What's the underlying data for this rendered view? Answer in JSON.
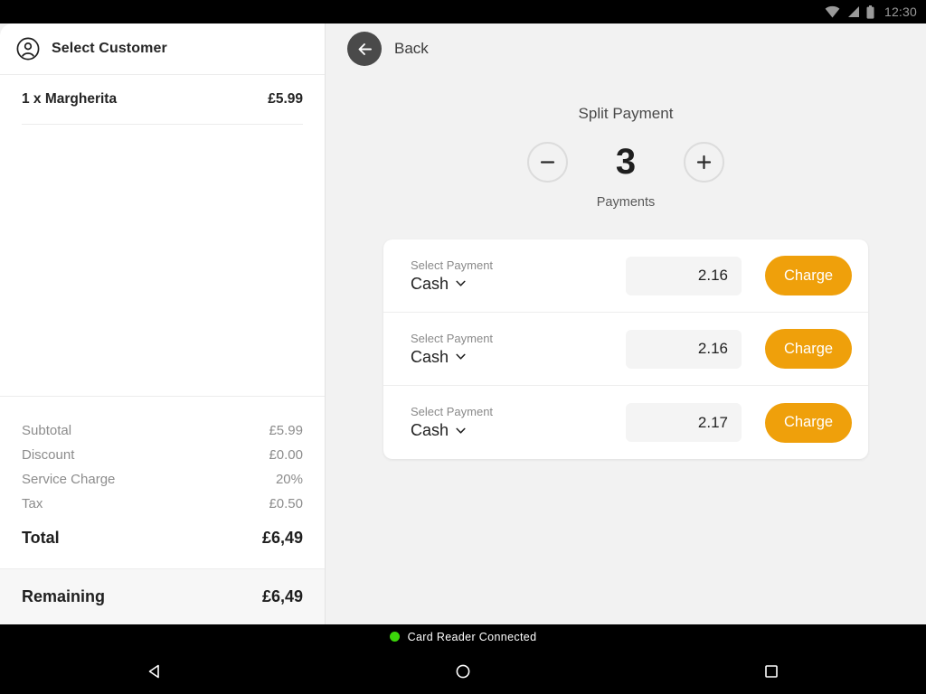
{
  "statusbar": {
    "time": "12:30",
    "icons": [
      "wifi-icon",
      "signal-icon",
      "battery-icon"
    ]
  },
  "ticket": {
    "customer": {
      "label": "Select Customer",
      "icon": "user-circle-icon"
    },
    "line_items": [
      {
        "name": "1 x Margherita",
        "price": "£5.99"
      }
    ],
    "totals": [
      {
        "label": "Subtotal",
        "value": "£5.99"
      },
      {
        "label": "Discount",
        "value": "£0.00"
      },
      {
        "label": "Service Charge",
        "value": "20%"
      },
      {
        "label": "Tax",
        "value": "£0.50"
      }
    ],
    "grand_total": {
      "label": "Total",
      "value": "£6,49"
    },
    "remaining": {
      "label": "Remaining",
      "value": "£6,49"
    }
  },
  "split": {
    "back_label": "Back",
    "back_icon": "arrow-left-icon",
    "title": "Split Payment",
    "decrement_icon": "minus-icon",
    "increment_icon": "plus-icon",
    "count": "3",
    "count_label": "Payments",
    "rows": [
      {
        "hint": "Select Payment",
        "method": "Cash",
        "chevron": "chevron-down-icon",
        "amount": "2.16",
        "amount_placeholder": "0.00",
        "charge_label": "Charge"
      },
      {
        "hint": "Select Payment",
        "method": "Cash",
        "chevron": "chevron-down-icon",
        "amount": "2.16",
        "amount_placeholder": "0.00",
        "charge_label": "Charge"
      },
      {
        "hint": "Select Payment",
        "method": "Cash",
        "chevron": "chevron-down-icon",
        "amount": "2.17",
        "amount_placeholder": "0.00",
        "charge_label": "Charge"
      }
    ]
  },
  "reader": {
    "status_text": "Card Reader Connected",
    "status_color": "#3bd60a"
  },
  "navbar": {
    "back": "back-triangle-icon",
    "home": "home-circle-icon",
    "recents": "recents-square-icon"
  },
  "colors": {
    "accent": "#efa00b",
    "panel": "#ffffff",
    "background": "#f2f2f2",
    "text": "#1f1f1f",
    "muted": "#8c8c8c"
  }
}
